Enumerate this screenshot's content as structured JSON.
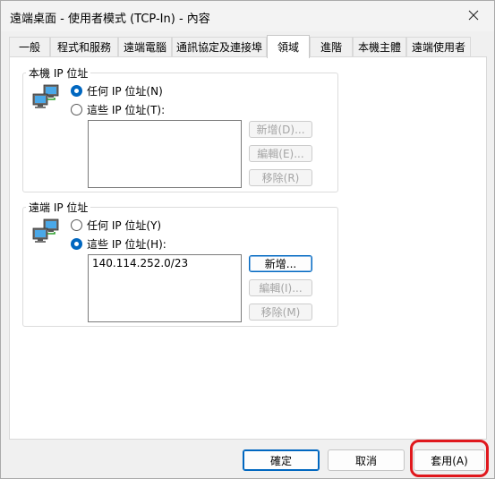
{
  "window": {
    "title": "遠端桌面 - 使用者模式 (TCP-In) - 內容"
  },
  "tabs": [
    {
      "label": "一般"
    },
    {
      "label": "程式和服務"
    },
    {
      "label": "遠端電腦"
    },
    {
      "label": "通訊協定及連接埠"
    },
    {
      "label": "領域"
    },
    {
      "label": "進階"
    },
    {
      "label": "本機主體"
    },
    {
      "label": "遠端使用者"
    }
  ],
  "local_ip": {
    "title": "本機 IP 位址",
    "option_any": "任何 IP 位址(N)",
    "option_these": "這些 IP 位址(T):",
    "selected": "any",
    "list": [],
    "add_label": "新增(D)...",
    "edit_label": "編輯(E)...",
    "remove_label": "移除(R)"
  },
  "remote_ip": {
    "title": "遠端 IP 位址",
    "option_any": "任何 IP 位址(Y)",
    "option_these": "這些 IP 位址(H):",
    "selected": "these",
    "list": [
      "140.114.252.0/23"
    ],
    "add_label": "新增...",
    "edit_label": "編輯(I)...",
    "remove_label": "移除(M)"
  },
  "footer": {
    "ok_label": "確定",
    "cancel_label": "取消",
    "apply_label": "套用(A)"
  },
  "colors": {
    "accent": "#0067c0",
    "highlight": "#e0181d"
  }
}
